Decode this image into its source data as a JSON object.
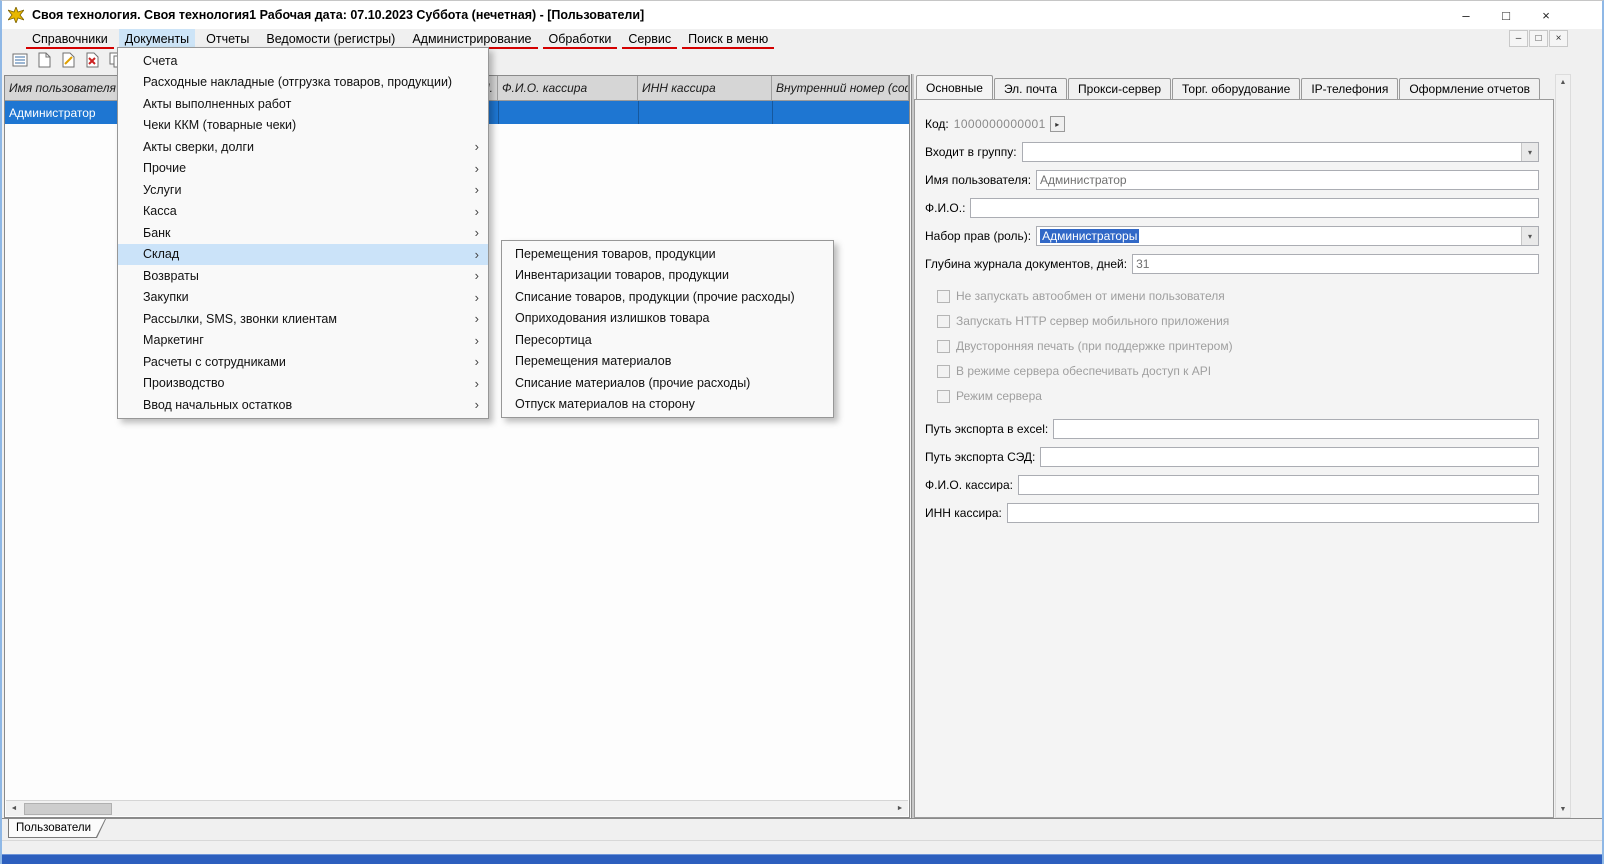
{
  "colors": {
    "selection_blue": "#1e76d2",
    "menu_highlight": "#cbe3f9",
    "menu_underline_red": "#d40000",
    "taskbar_blue": "#2d5fbe"
  },
  "icons": {
    "minimize": "–",
    "maximize": "□",
    "close": "×",
    "mdi_minimize": "–",
    "mdi_restore": "□",
    "mdi_close": "×",
    "submenu_arrow": "›",
    "combo_arrow": "▾",
    "code_button": "▸",
    "scroll_up": "▲",
    "scroll_down": "▼",
    "scroll_left": "◄",
    "scroll_right": "►"
  },
  "titlebar": {
    "title": "Своя технология. Своя технология1  Рабочая дата: 07.10.2023  Суббота (нечетная) - [Пользователи]"
  },
  "menubar": {
    "items": [
      "Справочники",
      "Документы",
      "Отчеты",
      "Ведомости (регистры)",
      "Администрирование",
      "Обработки",
      "Сервис",
      "Поиск в меню"
    ],
    "active_item": "Документы"
  },
  "menu_documents": {
    "items": [
      {
        "label": "Счета",
        "submenu": false
      },
      {
        "label": "Расходные накладные (отгрузка товаров, продукции)",
        "submenu": false
      },
      {
        "label": "Акты выполненных работ",
        "submenu": false
      },
      {
        "label": "Чеки ККМ (товарные чеки)",
        "submenu": false
      },
      {
        "label": "Акты сверки, долги",
        "submenu": true
      },
      {
        "label": "Прочие",
        "submenu": true
      },
      {
        "label": "Услуги",
        "submenu": true
      },
      {
        "label": "Касса",
        "submenu": true
      },
      {
        "label": "Банк",
        "submenu": true
      },
      {
        "label": "Склад",
        "submenu": true,
        "highlighted": true
      },
      {
        "label": "Возвраты",
        "submenu": true
      },
      {
        "label": "Закупки",
        "submenu": true
      },
      {
        "label": "Рассылки, SMS, звонки клиентам",
        "submenu": true
      },
      {
        "label": "Маркетинг",
        "submenu": true
      },
      {
        "label": "Расчеты с сотрудниками",
        "submenu": true
      },
      {
        "label": "Производство",
        "submenu": true
      },
      {
        "label": "Ввод начальных остатков",
        "submenu": true
      }
    ]
  },
  "menu_sklad": {
    "items": [
      "Перемещения товаров, продукции",
      "Инвентаризации товаров, продукции",
      "Списание товаров, продукции (прочие расходы)",
      "Оприходования излишков товара",
      "Пересортица",
      "Перемещения материалов",
      "Списание материалов (прочие расходы)",
      "Отпуск материалов на сторону"
    ]
  },
  "users_table": {
    "headers": {
      "username": "Имя пользователя",
      "truncated": "Ч.",
      "cashier_fio": "Ф.И.О. кассира",
      "cashier_inn": "ИНН кассира",
      "internal_number": "Внутренний номер (софтф"
    },
    "rows": [
      {
        "username": "Администратор",
        "selected": true
      }
    ]
  },
  "details_panel": {
    "tabs": [
      "Основные",
      "Эл. почта",
      "Прокси-сервер",
      "Торг. оборудование",
      "IP-телефония",
      "Оформление отчетов"
    ],
    "active_tab": "Основные",
    "code": {
      "label": "Код:",
      "value": "1000000000001"
    },
    "group": {
      "label": "Входит в группу:",
      "value": ""
    },
    "username": {
      "label": "Имя пользователя:",
      "value": "Администратор"
    },
    "fio": {
      "label": "Ф.И.О.:",
      "value": ""
    },
    "role": {
      "label": "Набор прав (роль):",
      "value": "Администраторы"
    },
    "journal_depth": {
      "label": "Глубина журнала документов, дней:",
      "value": "31"
    },
    "checkboxes": [
      {
        "label": "Не запускать автообмен от имени пользователя",
        "checked": false
      },
      {
        "label": "Запускать HTTP сервер мобильного приложения",
        "checked": false
      },
      {
        "label": "Двусторонняя печать (при поддержке принтером)",
        "checked": false
      },
      {
        "label": "В режиме сервера обеспечивать доступ к API",
        "checked": false
      },
      {
        "label": "Режим сервера",
        "checked": false
      }
    ],
    "excel_path": {
      "label": "Путь экспорта в excel:",
      "value": ""
    },
    "sed_path": {
      "label": "Путь экспорта СЭД:",
      "value": ""
    },
    "cashier_fio": {
      "label": "Ф.И.О. кассира:",
      "value": ""
    },
    "cashier_inn": {
      "label": "ИНН кассира:",
      "value": ""
    }
  },
  "bottom_bar": {
    "sheet_tab": "Пользователи"
  }
}
